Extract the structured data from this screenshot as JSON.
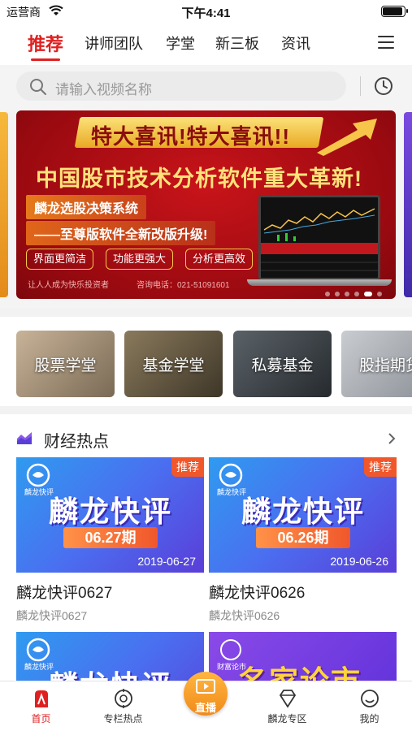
{
  "status_bar": {
    "carrier": "运营商",
    "time": "下午4:41"
  },
  "nav": {
    "tabs": [
      "推荐",
      "讲师团队",
      "学堂",
      "新三板",
      "资讯"
    ],
    "active_index": 0
  },
  "search": {
    "placeholder": "请输入视频名称"
  },
  "banner": {
    "ribbon": "特大喜讯!特大喜讯!!",
    "headline": "中国股市技术分析软件重大革新!",
    "sub1": "麟龙选股决策系统",
    "sub2": "——至尊版软件全新改版升级!",
    "pills": [
      "界面更简洁",
      "功能更强大",
      "分析更高效"
    ],
    "footer_left": "让人人成为快乐投资者",
    "footer_right": "咨询电话：021-51091601",
    "dot_count": 8,
    "active_dot": 5
  },
  "categories": [
    "股票学堂",
    "基金学堂",
    "私募基金",
    "股指期货"
  ],
  "section": {
    "title": "财经热点"
  },
  "videos": [
    {
      "badge": "推荐",
      "logo": "麟龙快评",
      "big_title": "麟龙快评",
      "issue": "06.27期",
      "date": "2019-06-27",
      "title": "麟龙快评0627",
      "subtitle": "麟龙快评0627"
    },
    {
      "badge": "推荐",
      "logo": "麟龙快评",
      "big_title": "麟龙快评",
      "issue": "06.26期",
      "date": "2019-06-26",
      "title": "麟龙快评0626",
      "subtitle": "麟龙快评0626"
    },
    {
      "logo": "麟龙快评",
      "big_title": "麟龙快评"
    },
    {
      "logo": "财富论市",
      "big_title": "名家论市"
    }
  ],
  "tabbar": {
    "items": [
      "首页",
      "专栏热点",
      "直播",
      "麟龙专区",
      "我的"
    ],
    "active_index": 0
  },
  "colors": {
    "accent": "#e02020",
    "live_orange": "#f5a030",
    "badge": "#f0572b"
  }
}
